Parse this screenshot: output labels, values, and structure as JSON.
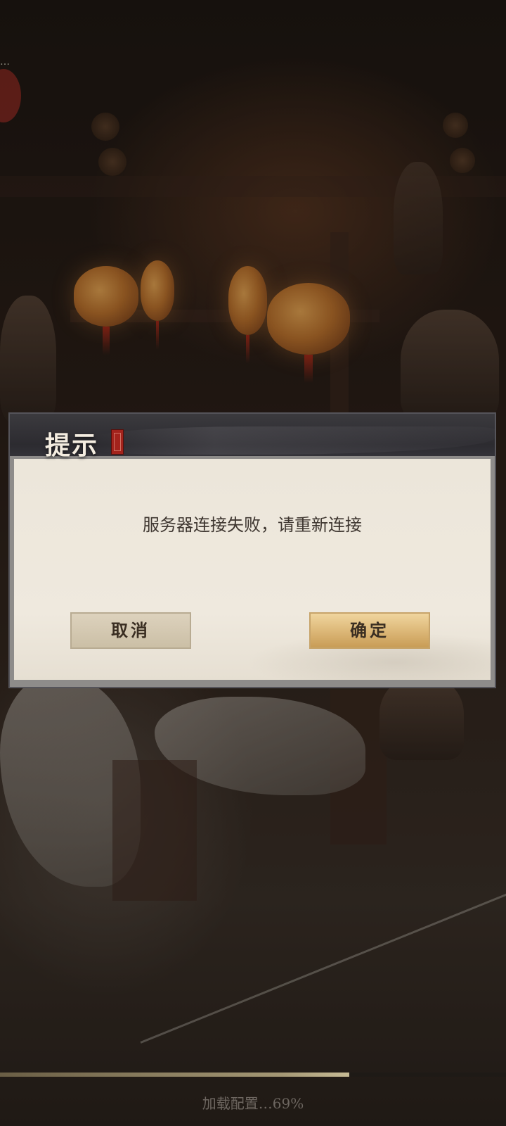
{
  "dialog": {
    "title": "提示",
    "message": "服务器连接失败，请重新连接",
    "cancel_label": "取消",
    "confirm_label": "确定"
  },
  "loading": {
    "text": "加载配置…69%",
    "progress": 0.69
  },
  "background": {
    "description_icon": "lantern-market-scene"
  },
  "colors": {
    "seal_red": "#a3231c",
    "confirm_gold": "#d9b372",
    "paper": "#ece6da"
  }
}
